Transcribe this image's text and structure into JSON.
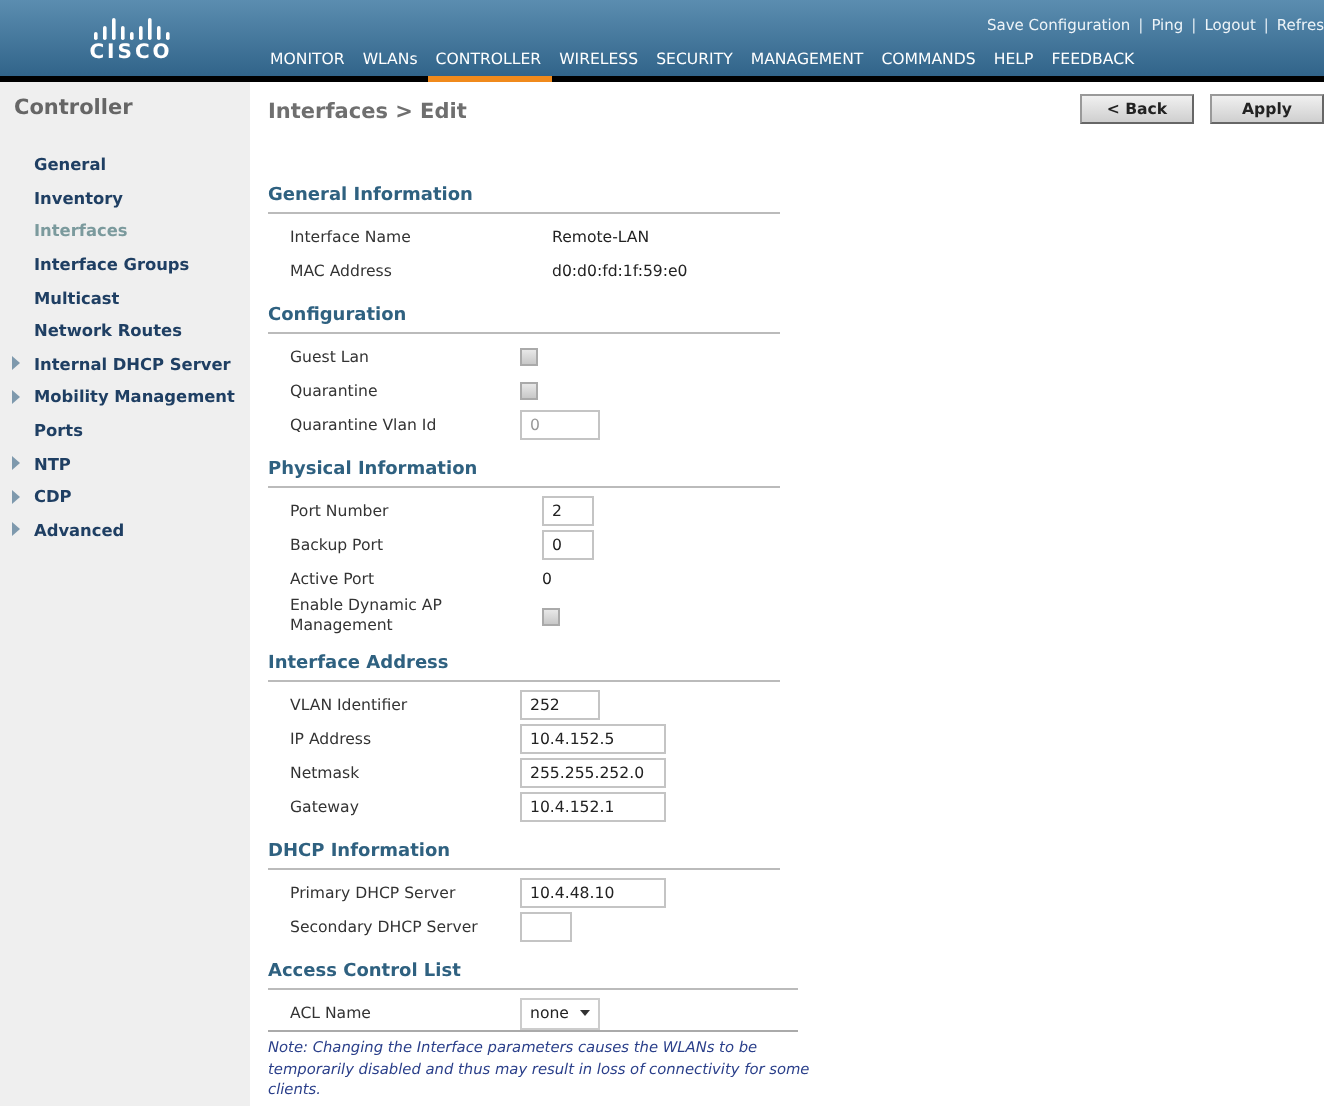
{
  "header": {
    "logo_text": "CISCO",
    "top_links": [
      "Save Configuration",
      "Ping",
      "Logout",
      "Refres"
    ],
    "top_separator": "|",
    "nav": [
      {
        "label": "MONITOR",
        "selected": false
      },
      {
        "label": "WLANs",
        "selected": false
      },
      {
        "label": "CONTROLLER",
        "selected": true
      },
      {
        "label": "WIRELESS",
        "selected": false
      },
      {
        "label": "SECURITY",
        "selected": false
      },
      {
        "label": "MANAGEMENT",
        "selected": false
      },
      {
        "label": "COMMANDS",
        "selected": false
      },
      {
        "label": "HELP",
        "selected": false
      },
      {
        "label": "FEEDBACK",
        "selected": false
      }
    ]
  },
  "sidebar": {
    "title": "Controller",
    "items": [
      {
        "label": "General",
        "selected": false,
        "expandable": false
      },
      {
        "label": "Inventory",
        "selected": false,
        "expandable": false
      },
      {
        "label": "Interfaces",
        "selected": true,
        "expandable": false
      },
      {
        "label": "Interface Groups",
        "selected": false,
        "expandable": false
      },
      {
        "label": "Multicast",
        "selected": false,
        "expandable": false
      },
      {
        "label": "Network Routes",
        "selected": false,
        "expandable": false
      },
      {
        "label": "Internal DHCP Server",
        "selected": false,
        "expandable": true
      },
      {
        "label": "Mobility Management",
        "selected": false,
        "expandable": true
      },
      {
        "label": "Ports",
        "selected": false,
        "expandable": false
      },
      {
        "label": "NTP",
        "selected": false,
        "expandable": true
      },
      {
        "label": "CDP",
        "selected": false,
        "expandable": true
      },
      {
        "label": "Advanced",
        "selected": false,
        "expandable": true
      }
    ]
  },
  "page": {
    "title": "Interfaces > Edit",
    "buttons": [
      "< Back",
      "Apply"
    ],
    "sections": [
      {
        "title": "General Information",
        "rows": [
          {
            "kind": "text",
            "label": "Interface Name",
            "value": "Remote-LAN"
          },
          {
            "kind": "text",
            "label": "MAC Address",
            "value": "d0:d0:fd:1f:59:e0"
          }
        ]
      },
      {
        "title": "Configuration",
        "rows": [
          {
            "kind": "checkbox",
            "label": "Guest Lan",
            "checked": false
          },
          {
            "kind": "checkbox",
            "label": "Quarantine",
            "checked": false
          },
          {
            "kind": "input",
            "label": "Quarantine Vlan Id",
            "value": "0",
            "disabled": true
          }
        ]
      },
      {
        "title": "Physical Information",
        "rows": [
          {
            "kind": "input",
            "label": "Port Number",
            "value": "2",
            "disabled": false
          },
          {
            "kind": "input",
            "label": "Backup Port",
            "value": "0",
            "disabled": false
          },
          {
            "kind": "text",
            "label": "Active Port",
            "value": "0"
          },
          {
            "kind": "checkbox",
            "label": "Enable Dynamic AP Management",
            "checked": false
          }
        ]
      },
      {
        "title": "Interface Address",
        "rows": [
          {
            "kind": "input",
            "label": "VLAN Identifier",
            "value": "252",
            "disabled": false
          },
          {
            "kind": "input",
            "label": "IP Address",
            "value": "10.4.152.5",
            "disabled": false
          },
          {
            "kind": "input",
            "label": "Netmask",
            "value": "255.255.252.0",
            "disabled": false
          },
          {
            "kind": "input",
            "label": "Gateway",
            "value": "10.4.152.1",
            "disabled": false
          }
        ]
      },
      {
        "title": "DHCP Information",
        "rows": [
          {
            "kind": "input",
            "label": "Primary DHCP Server",
            "value": "10.4.48.10",
            "disabled": false
          },
          {
            "kind": "input",
            "label": "Secondary DHCP Server",
            "value": "",
            "disabled": false
          }
        ]
      },
      {
        "title": "Access Control List",
        "rows": [
          {
            "kind": "select",
            "label": "ACL Name",
            "value": "none"
          }
        ]
      }
    ],
    "note": "Note: Changing the Interface parameters causes the WLANs to be temporarily disabled and thus may result in loss of connectivity for some clients."
  }
}
